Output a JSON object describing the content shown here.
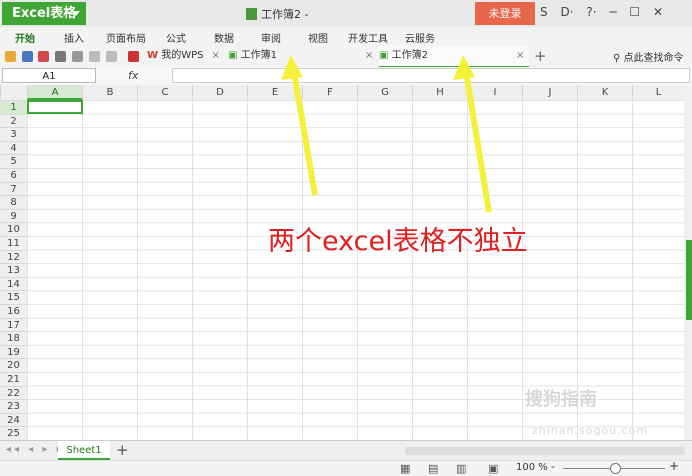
{
  "titlebar": {
    "app_label": "Excel表格",
    "doc_title": "工作簿2 -",
    "login": "未登录",
    "window_controls": [
      "S",
      "D·",
      "?·",
      "─",
      "☐",
      "✕"
    ]
  },
  "menu": {
    "items": [
      "开始",
      "插入",
      "页面布局",
      "公式",
      "数据",
      "审阅",
      "视图",
      "开发工具",
      "云服务"
    ]
  },
  "tabs": [
    {
      "label": "我的WPS"
    },
    {
      "label": "工作簿1"
    },
    {
      "label": "工作簿2"
    }
  ],
  "search": {
    "label": "点此查找命令"
  },
  "formula_bar": {
    "cell_ref": "A1",
    "fx": "fx"
  },
  "columns": [
    "A",
    "B",
    "C",
    "D",
    "E",
    "F",
    "G",
    "H",
    "I",
    "J",
    "K",
    "L"
  ],
  "rows": [
    "1",
    "2",
    "3",
    "4",
    "5",
    "6",
    "7",
    "8",
    "9",
    "10",
    "11",
    "12",
    "13",
    "14",
    "15",
    "16",
    "17",
    "18",
    "19",
    "20",
    "21",
    "22",
    "23",
    "24",
    "25"
  ],
  "sheet": {
    "tab": "Sheet1",
    "add": "+"
  },
  "status": {
    "zoom": "100 %",
    "minus": "-",
    "plus": "+"
  },
  "annotation": "两个excel表格不独立",
  "watermark": {
    "line1": "搜狗指南",
    "line2": "zhinan.sogou.com"
  },
  "colors": {
    "accent": "#3fa534",
    "login": "#e8664a",
    "annotation": "#e02020",
    "arrow": "#f5f03a"
  }
}
